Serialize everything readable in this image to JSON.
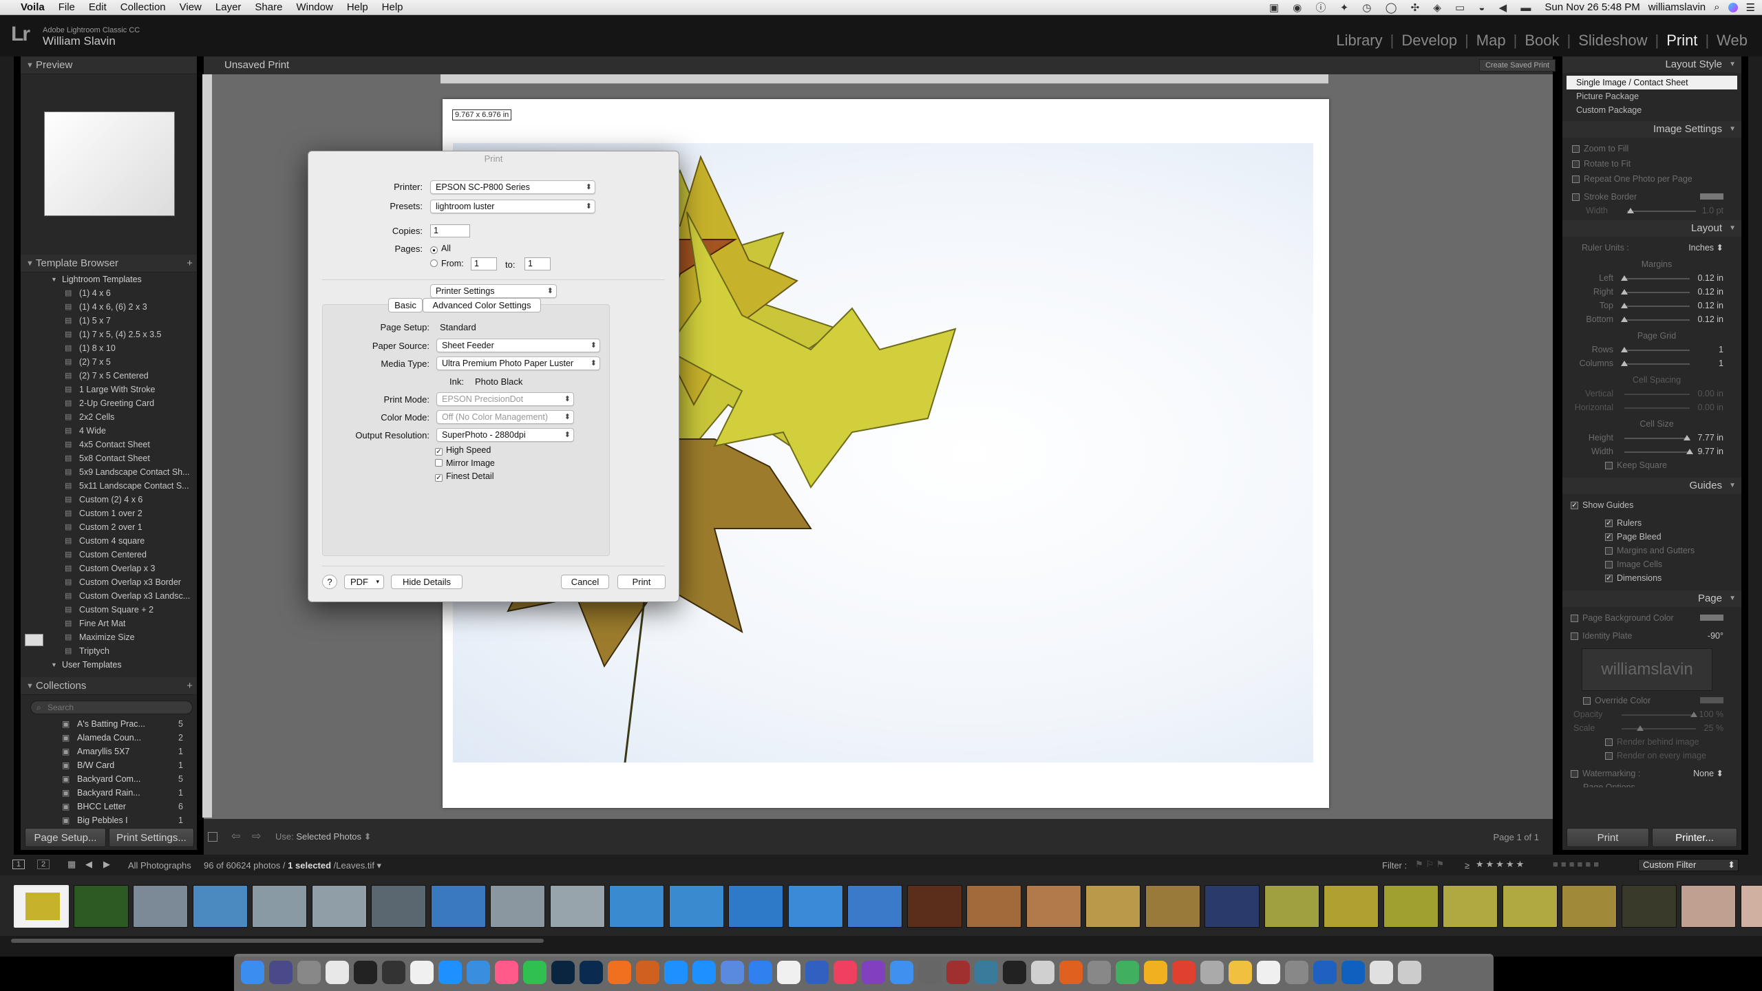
{
  "menubar": {
    "apple": "",
    "items": [
      "Voila",
      "File",
      "Edit",
      "Collection",
      "View",
      "Layer",
      "Share",
      "Window",
      "Help",
      "Help"
    ],
    "datetime": "Sun Nov 26  5:48 PM",
    "user": "williamslavin"
  },
  "identity": {
    "logo": "Lr",
    "app": "Adobe Lightroom Classic CC",
    "user": "William Slavin"
  },
  "modules": [
    "Library",
    "Develop",
    "Map",
    "Book",
    "Slideshow",
    "Print",
    "Web"
  ],
  "active_module": "Print",
  "left": {
    "preview_label": "Preview",
    "template_browser_label": "Template Browser",
    "lr_templates_label": "Lightroom Templates",
    "templates": [
      "(1) 4 x 6",
      "(1) 4 x 6, (6) 2 x 3",
      "(1) 5 x 7",
      "(1) 7 x 5, (4) 2.5 x 3.5",
      "(1) 8 x 10",
      "(2) 7 x 5",
      "(2) 7 x 5 Centered",
      "1 Large With Stroke",
      "2-Up Greeting Card",
      "2x2 Cells",
      "4 Wide",
      "4x5 Contact Sheet",
      "5x8 Contact Sheet",
      "5x9 Landscape Contact Sh...",
      "5x11 Landscape Contact S...",
      "Custom (2) 4 x 6",
      "Custom 1 over 2",
      "Custom 2 over 1",
      "Custom 4 square",
      "Custom Centered",
      "Custom Overlap x 3",
      "Custom Overlap x3 Border",
      "Custom Overlap x3 Landsc...",
      "Custom Square + 2",
      "Fine Art Mat",
      "Maximize Size",
      "Triptych"
    ],
    "user_templates_label": "User Templates",
    "collections_label": "Collections",
    "search_placeholder": "Search",
    "collections": [
      {
        "name": "A's Batting Prac...",
        "count": "5"
      },
      {
        "name": "Alameda Coun...",
        "count": "2"
      },
      {
        "name": "Amaryllis 5X7",
        "count": "1"
      },
      {
        "name": "B/W Card",
        "count": "1"
      },
      {
        "name": "Backyard Com...",
        "count": "5"
      },
      {
        "name": "Backyard Rain...",
        "count": "1"
      },
      {
        "name": "BHCC Letter",
        "count": "6"
      },
      {
        "name": "Big Pebbles I",
        "count": "1"
      }
    ],
    "page_setup_btn": "Page Setup...",
    "print_settings_btn": "Print Settings..."
  },
  "center": {
    "title": "Unsaved Print",
    "create_saved_btn": "Create Saved Print",
    "dimensions": "9.767 x 6.976 in",
    "use_label": "Use:",
    "use_value": "Selected Photos",
    "page_of": "Page 1 of 1"
  },
  "dialog": {
    "title": "Print",
    "printer_label": "Printer:",
    "printer_value": "EPSON SC-P800 Series",
    "presets_label": "Presets:",
    "presets_value": "lightroom luster",
    "copies_label": "Copies:",
    "copies_value": "1",
    "pages_label": "Pages:",
    "pages_all": "All",
    "pages_from": "From:",
    "pages_from_value": "1",
    "pages_to": "to:",
    "pages_to_value": "1",
    "section_popup": "Printer Settings",
    "tab_basic": "Basic",
    "tab_advanced": "Advanced Color Settings",
    "page_setup_label": "Page Setup:",
    "page_setup_value": "Standard",
    "paper_source_label": "Paper Source:",
    "paper_source_value": "Sheet Feeder",
    "media_type_label": "Media Type:",
    "media_type_value": "Ultra Premium Photo Paper Luster",
    "ink_label": "Ink:",
    "ink_value": "Photo Black",
    "print_mode_label": "Print Mode:",
    "print_mode_value": "EPSON PrecisionDot",
    "color_mode_label": "Color Mode:",
    "color_mode_value": "Off (No Color Management)",
    "output_res_label": "Output Resolution:",
    "output_res_value": "SuperPhoto - 2880dpi",
    "high_speed": "High Speed",
    "mirror_image": "Mirror Image",
    "finest_detail": "Finest Detail",
    "help": "?",
    "pdf": "PDF",
    "hide_details": "Hide Details",
    "cancel": "Cancel",
    "print": "Print"
  },
  "right": {
    "layout_style_label": "Layout Style",
    "layout_styles": [
      "Single Image / Contact Sheet",
      "Picture Package",
      "Custom Package"
    ],
    "image_settings_label": "Image Settings",
    "zoom_to_fill": "Zoom to Fill",
    "rotate_to_fit": "Rotate to Fit",
    "repeat_one": "Repeat One Photo per Page",
    "stroke_border": "Stroke Border",
    "width_label": "Width",
    "width_value": "1.0 pt",
    "layout_label": "Layout",
    "ruler_units_label": "Ruler Units :",
    "ruler_units_value": "Inches",
    "margins_label": "Margins",
    "left_label": "Left",
    "left_value": "0.12 in",
    "right_label": "Right",
    "right_value": "0.12 in",
    "top_label": "Top",
    "top_value": "0.12 in",
    "bottom_label": "Bottom",
    "bottom_value": "0.12 in",
    "page_grid_label": "Page Grid",
    "rows_label": "Rows",
    "rows_value": "1",
    "columns_label": "Columns",
    "columns_value": "1",
    "cell_spacing_label": "Cell Spacing",
    "vertical_label": "Vertical",
    "vertical_value": "0.00 in",
    "horizontal_label": "Horizontal",
    "horizontal_value": "0.00 in",
    "cell_size_label": "Cell Size",
    "height_label": "Height",
    "height_value": "7.77 in",
    "cwidth_label": "Width",
    "cwidth_value": "9.77 in",
    "keep_square": "Keep Square",
    "guides_label": "Guides",
    "show_guides": "Show Guides",
    "rulers": "Rulers",
    "page_bleed": "Page Bleed",
    "margins_gutters": "Margins and Gutters",
    "image_cells": "Image Cells",
    "dimensions": "Dimensions",
    "page_label": "Page",
    "page_bg_color": "Page Background Color",
    "identity_plate": "Identity Plate",
    "identity_angle": "-90°",
    "identity_text": "williamslavin",
    "override_color": "Override Color",
    "opacity_label": "Opacity",
    "opacity_value": "100 %",
    "scale_label": "Scale",
    "scale_value": "25 %",
    "render_behind": "Render behind image",
    "render_every": "Render on every image",
    "watermarking": "Watermarking :",
    "watermark_value": "None",
    "page_options": "Page Options",
    "print_btn": "Print",
    "printer_btn": "Printer..."
  },
  "filmstrip": {
    "page1": "1",
    "page2": "2",
    "source": "All Photographs",
    "count_info": "96 of 60624 photos /",
    "selected": "1 selected",
    "file": "/Leaves.tif",
    "filter_label": "Filter :",
    "rating_op": "≥",
    "custom_filter": "Custom Filter"
  },
  "colors": {
    "accent": "#f0f0f0",
    "panel": "#282828",
    "center_bg": "#6a6a6a"
  }
}
